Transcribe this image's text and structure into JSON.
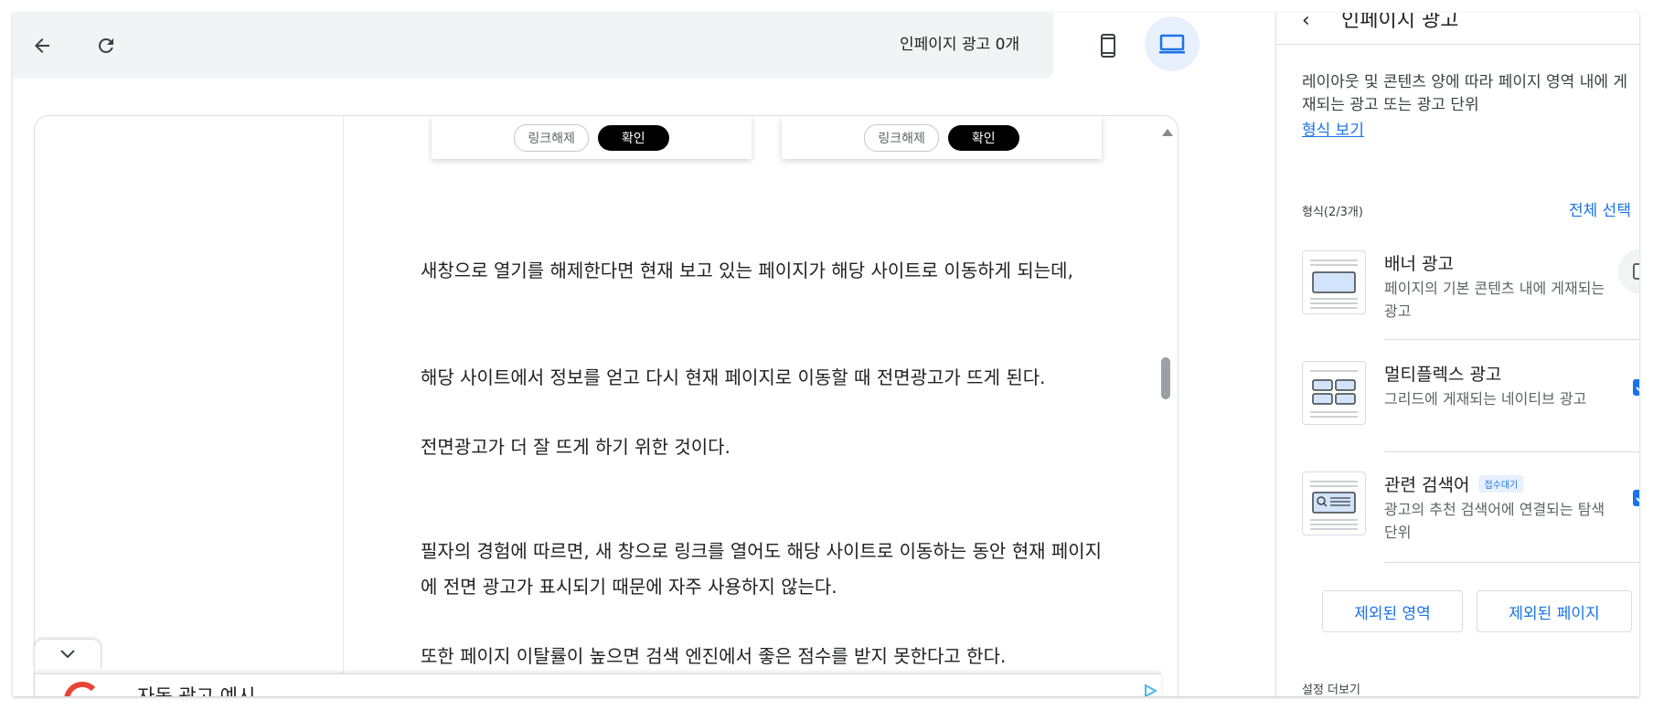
{
  "topbar": {
    "back_icon": "arrow-back-icon",
    "reload_icon": "reload-icon",
    "ad_count": "인페이지 광고 0개",
    "mobile_icon": "smartphone-icon",
    "desktop_icon": "laptop-icon"
  },
  "preview": {
    "dialogs": [
      {
        "unlink": "링크해제",
        "confirm": "확인"
      },
      {
        "unlink": "링크해제",
        "confirm": "확인"
      }
    ],
    "article": [
      "새창으로 열기를 해제한다면 현재 보고 있는 페이지가 해당 사이트로 이동하게 되는데,",
      "해당 사이트에서 정보를 얻고 다시 현재 페이지로 이동할 때 전면광고가 뜨게 된다.",
      "전면광고가 더 잘 뜨게 하기 위한 것이다.",
      "필자의 경험에 따르면, 새 창으로 링크를 열어도 해당 사이트로 이동하는 동안 현재 페이지에 전면 광고가 표시되기 때문에 자주 사용하지 않는다.",
      "또한 페이지 이탈률이 높으면 검색 엔진에서 좋은 점수를 받지 못한다고 한다."
    ],
    "ad_bar_title": "자동 광고 예시"
  },
  "panel": {
    "header_title": "인페이지 광고",
    "description": "레이아웃 및 콘텐츠 양에 따라 페이지 영역 내에 게재되는 광고 또는 광고 단위",
    "view_formats": "형식 보기",
    "formats_count": "형식(2/3개)",
    "select_all": "전체 선택",
    "formats": [
      {
        "title": "배너 광고",
        "desc": "페이지의 기본 콘텐츠 내에 게재되는 광고",
        "checked": false,
        "badge": ""
      },
      {
        "title": "멀티플렉스 광고",
        "desc": "그리드에 게재되는 네이티브 광고",
        "checked": true,
        "badge": ""
      },
      {
        "title": "관련 검색어",
        "desc": "광고의 추천 검색어에 연결되는 탐색 단위",
        "checked": true,
        "badge": "접수대기"
      }
    ],
    "excluded_areas": "제외된 영역",
    "excluded_pages": "제외된 페이지",
    "more_settings": "설정 더보기"
  },
  "colors": {
    "accent": "#1a73e8",
    "toolbar_bg": "#f1f3f4",
    "selected_bg": "#e8f0fe"
  }
}
